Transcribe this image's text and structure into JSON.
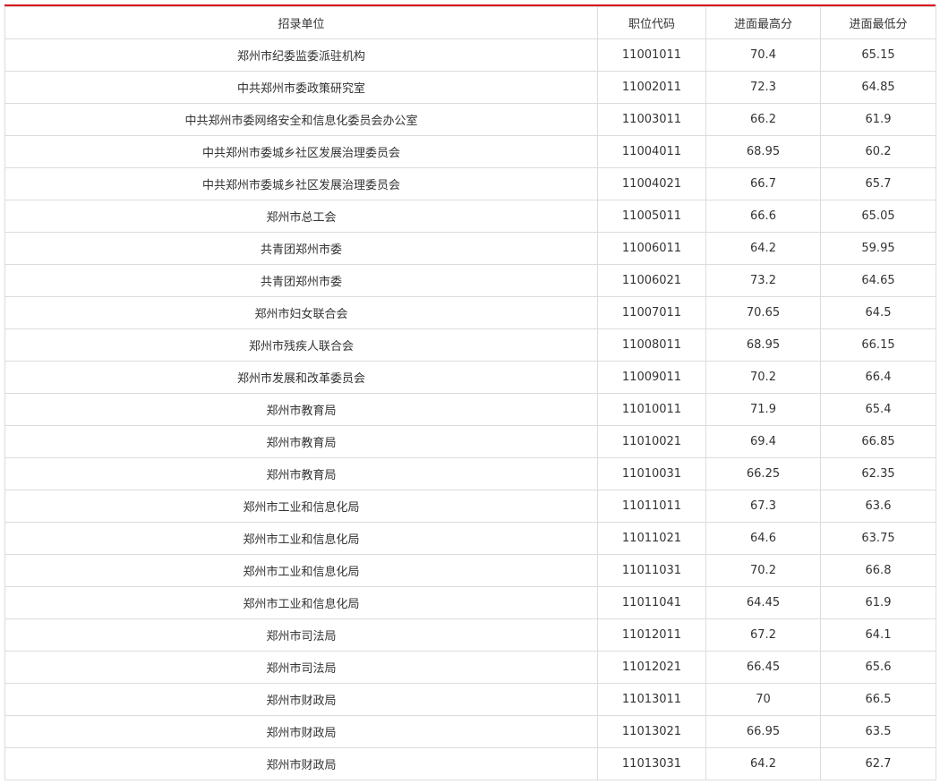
{
  "colors": {
    "accent_bar": "#d7000f",
    "border": "#dcdcdc",
    "text": "#333333"
  },
  "table": {
    "headers": [
      "招录单位",
      "职位代码",
      "进面最高分",
      "进面最低分"
    ],
    "rows": [
      [
        "郑州市纪委监委派驻机构",
        "11001011",
        "70.4",
        "65.15"
      ],
      [
        "中共郑州市委政策研究室",
        "11002011",
        "72.3",
        "64.85"
      ],
      [
        "中共郑州市委网络安全和信息化委员会办公室",
        "11003011",
        "66.2",
        "61.9"
      ],
      [
        "中共郑州市委城乡社区发展治理委员会",
        "11004011",
        "68.95",
        "60.2"
      ],
      [
        "中共郑州市委城乡社区发展治理委员会",
        "11004021",
        "66.7",
        "65.7"
      ],
      [
        "郑州市总工会",
        "11005011",
        "66.6",
        "65.05"
      ],
      [
        "共青团郑州市委",
        "11006011",
        "64.2",
        "59.95"
      ],
      [
        "共青团郑州市委",
        "11006021",
        "73.2",
        "64.65"
      ],
      [
        "郑州市妇女联合会",
        "11007011",
        "70.65",
        "64.5"
      ],
      [
        "郑州市残疾人联合会",
        "11008011",
        "68.95",
        "66.15"
      ],
      [
        "郑州市发展和改革委员会",
        "11009011",
        "70.2",
        "66.4"
      ],
      [
        "郑州市教育局",
        "11010011",
        "71.9",
        "65.4"
      ],
      [
        "郑州市教育局",
        "11010021",
        "69.4",
        "66.85"
      ],
      [
        "郑州市教育局",
        "11010031",
        "66.25",
        "62.35"
      ],
      [
        "郑州市工业和信息化局",
        "11011011",
        "67.3",
        "63.6"
      ],
      [
        "郑州市工业和信息化局",
        "11011021",
        "64.6",
        "63.75"
      ],
      [
        "郑州市工业和信息化局",
        "11011031",
        "70.2",
        "66.8"
      ],
      [
        "郑州市工业和信息化局",
        "11011041",
        "64.45",
        "61.9"
      ],
      [
        "郑州市司法局",
        "11012011",
        "67.2",
        "64.1"
      ],
      [
        "郑州市司法局",
        "11012021",
        "66.45",
        "65.6"
      ],
      [
        "郑州市财政局",
        "11013011",
        "70",
        "66.5"
      ],
      [
        "郑州市财政局",
        "11013021",
        "66.95",
        "63.5"
      ],
      [
        "郑州市财政局",
        "11013031",
        "64.2",
        "62.7"
      ]
    ]
  }
}
